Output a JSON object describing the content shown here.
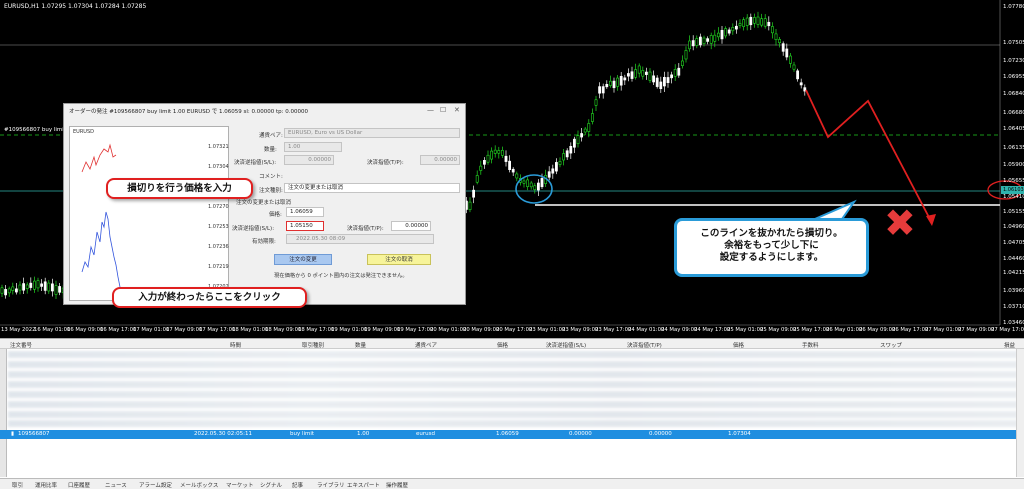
{
  "chart": {
    "title": "EURUSD,H1  1.07295 1.07304 1.07284 1.07285",
    "order_line_label": "#109566807 buy limit 1.06",
    "current_price": "1.06103",
    "price_axis": [
      "1.07780",
      "1.07505",
      "1.07230",
      "1.06955",
      "1.06840",
      "1.06680",
      "1.06405",
      "1.06135",
      "1.05900",
      "1.05655",
      "1.05410",
      "1.05155",
      "1.04960",
      "1.04705",
      "1.04460",
      "1.04215",
      "1.03960",
      "1.03710",
      "1.03460"
    ],
    "date_axis": [
      "13 May 2022",
      "16 May 01:00",
      "16 May 09:00",
      "16 May 17:00",
      "17 May 01:00",
      "17 May 09:00",
      "17 May 17:00",
      "18 May 01:00",
      "18 May 09:00",
      "18 May 17:00",
      "19 May 01:00",
      "19 May 09:00",
      "19 May 17:00",
      "20 May 01:00",
      "20 May 09:00",
      "20 May 17:00",
      "23 May 01:00",
      "23 May 09:00",
      "23 May 17:00",
      "24 May 01:00",
      "24 May 09:00",
      "24 May 17:00",
      "25 May 01:00",
      "25 May 09:00",
      "25 May 17:00",
      "26 May 01:00",
      "26 May 09:00",
      "26 May 17:00",
      "27 May 01:00",
      "27 May 09:00",
      "27 May 17:00"
    ]
  },
  "dialog": {
    "title": "オーダーの発注 #109566807 buy limit 1.00 EURUSD で 1.06059 sl: 0.00000 tp: 0.00000",
    "mini_chart": {
      "symbol": "EURUSD",
      "prices": [
        "1.07321",
        "1.07304",
        "1.07287",
        "1.07270",
        "1.07253",
        "1.07236",
        "1.07219",
        "1.07202"
      ]
    },
    "symbol_label": "通貨ペア:",
    "symbol_value": "EURUSD, Euro vs US Dollar",
    "volume_label": "数量:",
    "volume_value": "1.00",
    "sl_label": "決済逆指値(S/L):",
    "sl_value": "0.00000",
    "tp_label": "決済指値(T/P):",
    "tp_value": "0.00000",
    "comment_label": "コメント:",
    "type_label": "注文種別:",
    "type_value": "注文の変更または取消",
    "section_label": "注文の変更または取消",
    "price_label": "価格:",
    "price_value": "1.06059",
    "new_sl_label": "決済逆指値(S/L):",
    "new_sl_value": "1.05150",
    "new_tp_label": "決済指値(T/P):",
    "new_tp_value": "0.00000",
    "expiry_label": "有効期限:",
    "expiry_value": "2022.05.30 08:09",
    "modify_button": "注文の変更",
    "cancel_button": "注文の取消",
    "warning": "現在価格から 0 ポイント圏内の注文は発注できません。"
  },
  "callouts": {
    "sl_price": "損切りを行う価格を入力",
    "click_here": "入力が終わったらここをクリック",
    "line_note_1": "このラインを抜かれたら損切り。",
    "line_note_2": "余裕をもって少し下に",
    "line_note_3": "設定するようにします。"
  },
  "terminal": {
    "columns": [
      "注文番号",
      "時間",
      "取引種別",
      "数量",
      "通貨ペア",
      "価格",
      "決済逆指値(S/L)",
      "決済指値(T/P)",
      "価格",
      "手数料",
      "スワップ",
      "損益"
    ],
    "selected_row": {
      "order": "109566807",
      "time": "2022.05.30 02:05:11",
      "type": "buy limit",
      "volume": "1.00",
      "symbol": "eurusd",
      "price": "1.06059",
      "sl": "0.00000",
      "tp": "0.00000",
      "current": "1.07304"
    },
    "tabs": [
      "取引",
      "運用比率",
      "口座履歴",
      "ニュース",
      "アラーム設定",
      "メールボックス",
      "マーケット",
      "シグナル",
      "記事",
      "ライブラリ",
      "エキスパート",
      "操作履歴"
    ],
    "side_label": "ターミナル"
  },
  "colors": {
    "bull": "#22dd22",
    "accent_red": "#e02020",
    "accent_blue": "#2a9bd8",
    "selection": "#1f8ee0"
  }
}
